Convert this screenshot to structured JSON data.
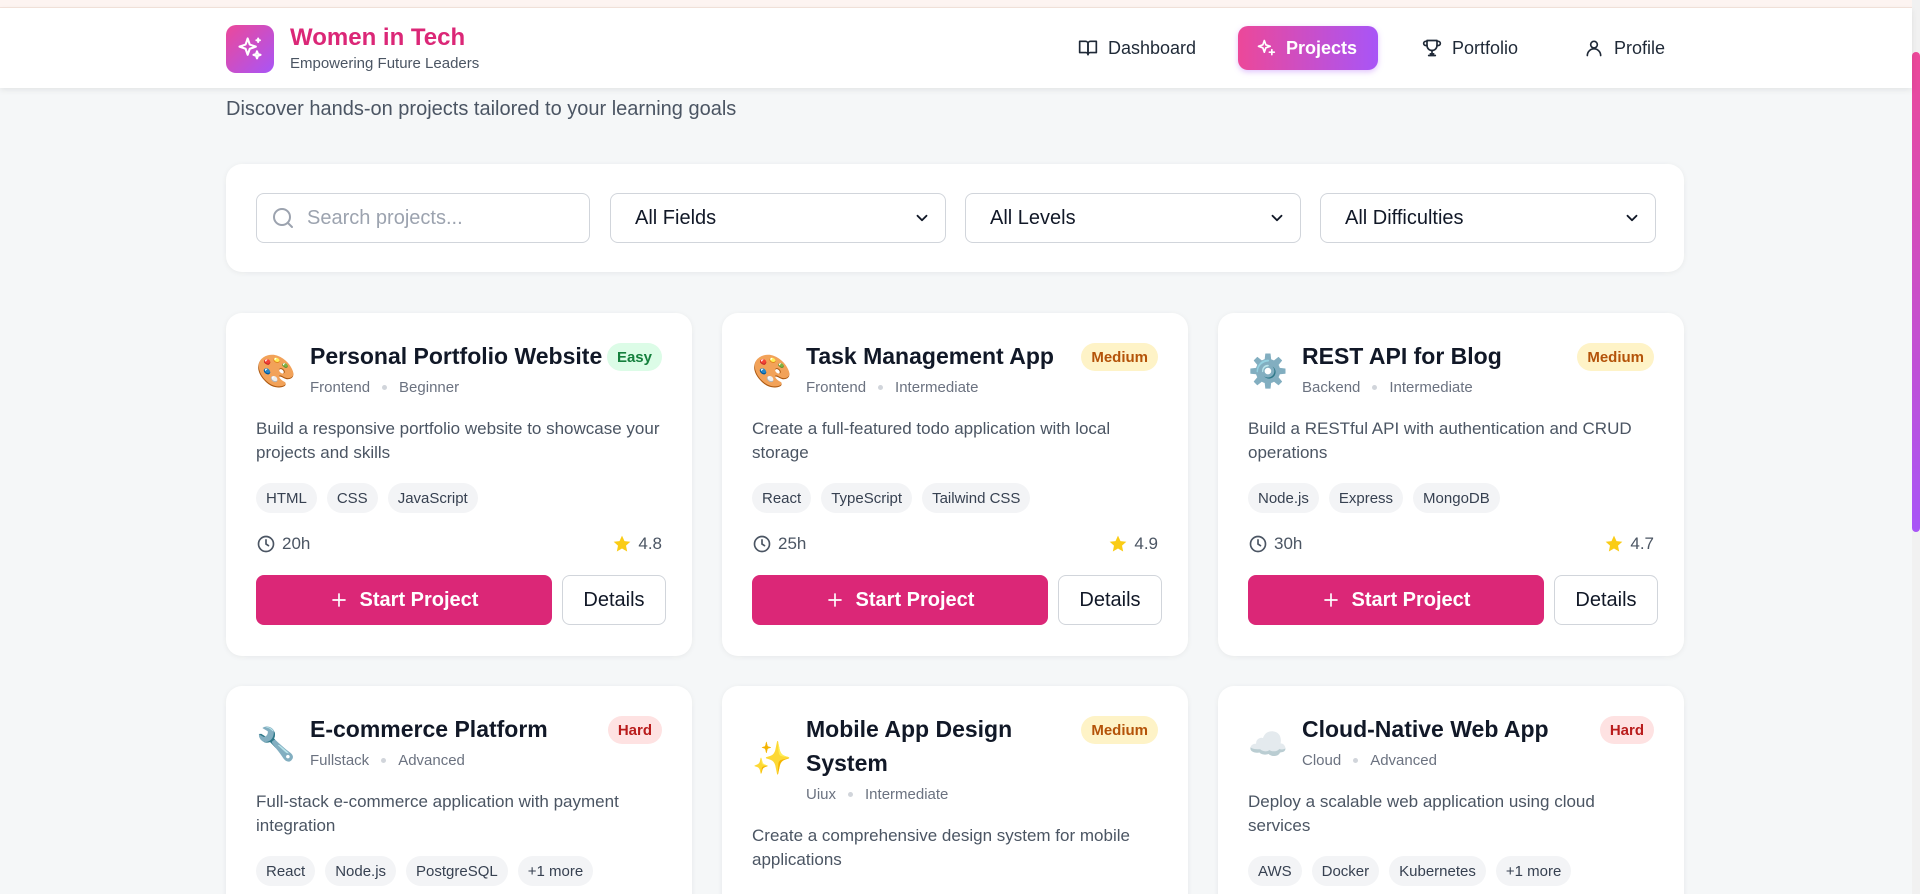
{
  "brand": {
    "title": "Women in Tech",
    "subtitle": "Empowering Future Leaders"
  },
  "nav": [
    {
      "label": "Dashboard",
      "icon": "book-icon",
      "active": false
    },
    {
      "label": "Projects",
      "icon": "sparkles-icon",
      "active": true
    },
    {
      "label": "Portfolio",
      "icon": "trophy-icon",
      "active": false
    },
    {
      "label": "Profile",
      "icon": "user-icon",
      "active": false
    }
  ],
  "page": {
    "subtitle": "Discover hands-on projects tailored to your learning goals"
  },
  "filters": {
    "search_placeholder": "Search projects...",
    "fields": "All Fields",
    "levels": "All Levels",
    "difficulties": "All Difficulties"
  },
  "colors": {
    "accent": "#db2777",
    "gradient_start": "#ec4899",
    "gradient_end": "#a855f7"
  },
  "projects": [
    {
      "emoji": "🎨",
      "title": "Personal Portfolio Website",
      "field": "Frontend",
      "level": "Beginner",
      "difficulty": "Easy",
      "description": "Build a responsive portfolio website to showcase your projects and skills",
      "tags": [
        "HTML",
        "CSS",
        "JavaScript"
      ],
      "hours": "20h",
      "rating": "4.8",
      "start_label": "Start Project",
      "details_label": "Details"
    },
    {
      "emoji": "🎨",
      "title": "Task Management App",
      "field": "Frontend",
      "level": "Intermediate",
      "difficulty": "Medium",
      "description": "Create a full-featured todo application with local storage",
      "tags": [
        "React",
        "TypeScript",
        "Tailwind CSS"
      ],
      "hours": "25h",
      "rating": "4.9",
      "start_label": "Start Project",
      "details_label": "Details"
    },
    {
      "emoji": "⚙️",
      "title": "REST API for Blog",
      "field": "Backend",
      "level": "Intermediate",
      "difficulty": "Medium",
      "description": "Build a RESTful API with authentication and CRUD operations",
      "tags": [
        "Node.js",
        "Express",
        "MongoDB"
      ],
      "hours": "30h",
      "rating": "4.7",
      "start_label": "Start Project",
      "details_label": "Details"
    },
    {
      "emoji": "🔧",
      "title": "E-commerce Platform",
      "field": "Fullstack",
      "level": "Advanced",
      "difficulty": "Hard",
      "description": "Full-stack e-commerce application with payment integration",
      "tags": [
        "React",
        "Node.js",
        "PostgreSQL",
        "+1 more"
      ]
    },
    {
      "emoji": "✨",
      "title": "Mobile App Design System",
      "field": "Uiux",
      "level": "Intermediate",
      "difficulty": "Medium",
      "description": "Create a comprehensive design system for mobile applications"
    },
    {
      "emoji": "☁️",
      "title": "Cloud-Native Web App",
      "field": "Cloud",
      "level": "Advanced",
      "difficulty": "Hard",
      "description": "Deploy a scalable web application using cloud services",
      "tags": [
        "AWS",
        "Docker",
        "Kubernetes",
        "+1 more"
      ]
    }
  ]
}
